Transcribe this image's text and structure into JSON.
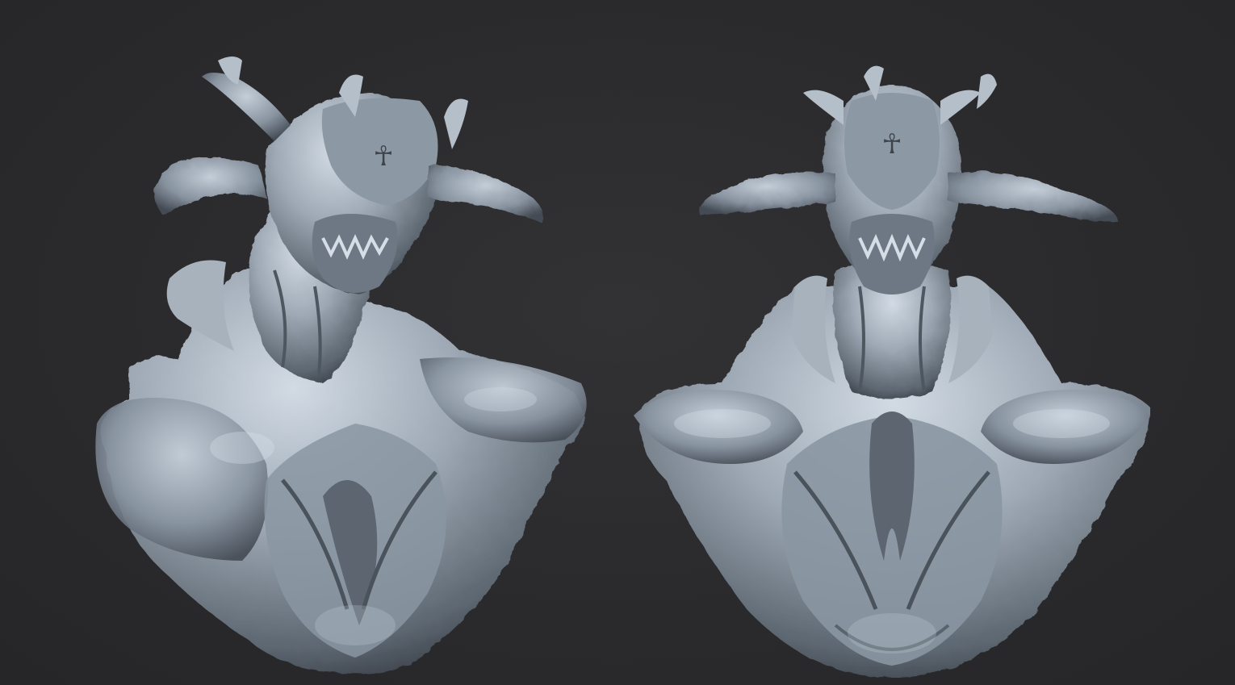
{
  "viewport": {
    "background": "#2b2b2d"
  },
  "material": {
    "base": "#9aa6b2",
    "light": "#c9d3dd",
    "shadow": "#4b535c",
    "deep": "#2e3338"
  },
  "sculpts": [
    {
      "name": "creature-bust-three-quarter-left",
      "view": "three-quarter"
    },
    {
      "name": "creature-bust-front",
      "view": "front"
    }
  ]
}
